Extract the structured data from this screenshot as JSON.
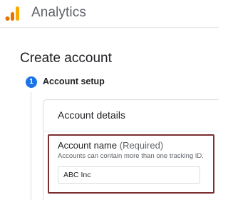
{
  "app": {
    "title": "Analytics",
    "logo_colors": [
      "#f9ab00",
      "#e37400",
      "#e37400"
    ]
  },
  "page": {
    "title": "Create account"
  },
  "stepper": {
    "steps": [
      {
        "number": "1",
        "label": "Account setup",
        "state": "active"
      }
    ],
    "accent": "#1a73e8"
  },
  "account_details": {
    "title": "Account details",
    "account_name": {
      "label": "Account name",
      "required": "(Required)",
      "help": "Accounts can contain more than one tracking ID.",
      "value": "ABC Inc",
      "highlight_color": "#7a2e2e"
    }
  }
}
